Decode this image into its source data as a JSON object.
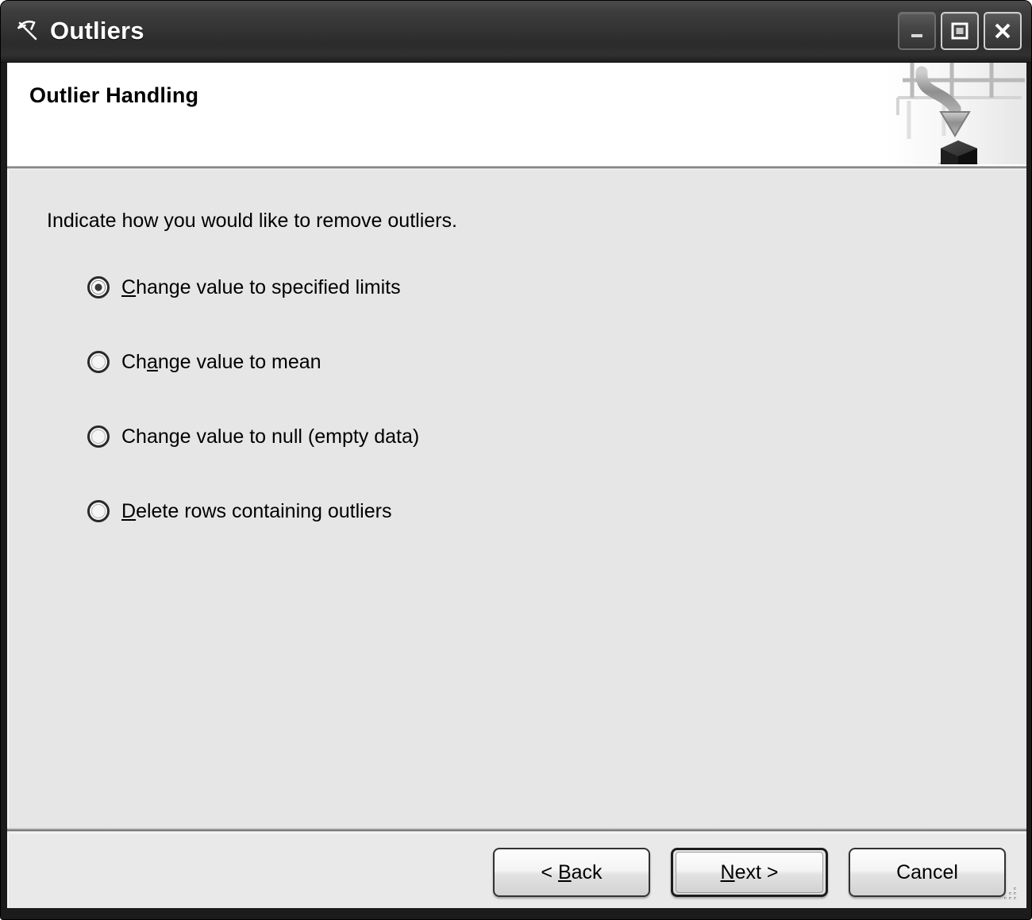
{
  "window": {
    "title": "Outliers",
    "title_icon": "pickaxe-icon",
    "controls": [
      {
        "name": "minimize",
        "glyph": "minimize-icon"
      },
      {
        "name": "maximize",
        "glyph": "maximize-icon"
      },
      {
        "name": "close",
        "glyph": "close-icon"
      }
    ]
  },
  "header": {
    "title": "Outlier Handling",
    "artwork": "grid-arrow-cube-banner"
  },
  "content": {
    "instruction": "Indicate how you would like to remove outliers.",
    "options": [
      {
        "id": "specified-limits",
        "pre": "C",
        "mnemonic": "",
        "label_full": "Change value to specified limits",
        "before": "",
        "accel": "C",
        "after": "hange value to specified limits",
        "selected": true
      },
      {
        "id": "mean",
        "label_full": "Change value to mean",
        "before": "Ch",
        "accel": "a",
        "after": "nge value to mean",
        "selected": false
      },
      {
        "id": "null-empty-data",
        "label_full": "Change value to null (empty data)",
        "before": "Chan",
        "accel": "g",
        "after": "e value to null (empty data)",
        "selected": false
      },
      {
        "id": "delete-rows",
        "label_full": "Delete rows containing outliers",
        "before": "",
        "accel": "D",
        "after": "elete rows containing outliers",
        "selected": false
      }
    ]
  },
  "footer": {
    "buttons": [
      {
        "id": "back",
        "before": "< ",
        "accel": "B",
        "after": "ack",
        "default": false
      },
      {
        "id": "next",
        "before": "",
        "accel": "N",
        "after": "ext >",
        "default": true
      },
      {
        "id": "cancel",
        "before": "Cancel",
        "accel": "",
        "after": "",
        "default": false
      }
    ]
  },
  "colors": {
    "titlebar": "#343434",
    "header_bg": "#ffffff",
    "content_bg": "#e6e6e6",
    "footer_bg": "#e9e9e9",
    "text": "#000000"
  }
}
